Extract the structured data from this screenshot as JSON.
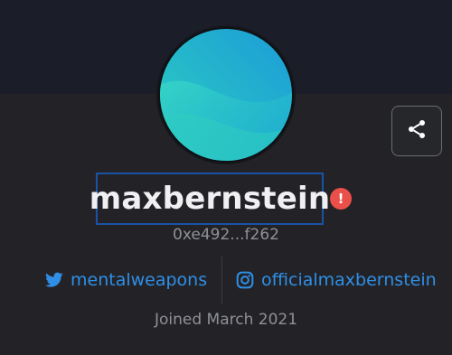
{
  "profile": {
    "username": "maxbernstein",
    "warning_badge": "!",
    "address": "0xe492...f262",
    "joined": "Joined March 2021"
  },
  "socials": {
    "twitter": {
      "handle": "mentalweapons",
      "icon": "twitter-icon"
    },
    "instagram": {
      "handle": "officialmaxbernstein",
      "icon": "instagram-icon"
    }
  },
  "actions": {
    "share_icon": "share-icon"
  },
  "colors": {
    "background": "#232327",
    "banner": "#1b1e29",
    "link": "#2f8fe6",
    "warning": "#ea4f4a",
    "selection_outline": "#1a52a6",
    "avatar_gradient_start": "#2fc9c2",
    "avatar_gradient_end": "#1e9ad6"
  }
}
